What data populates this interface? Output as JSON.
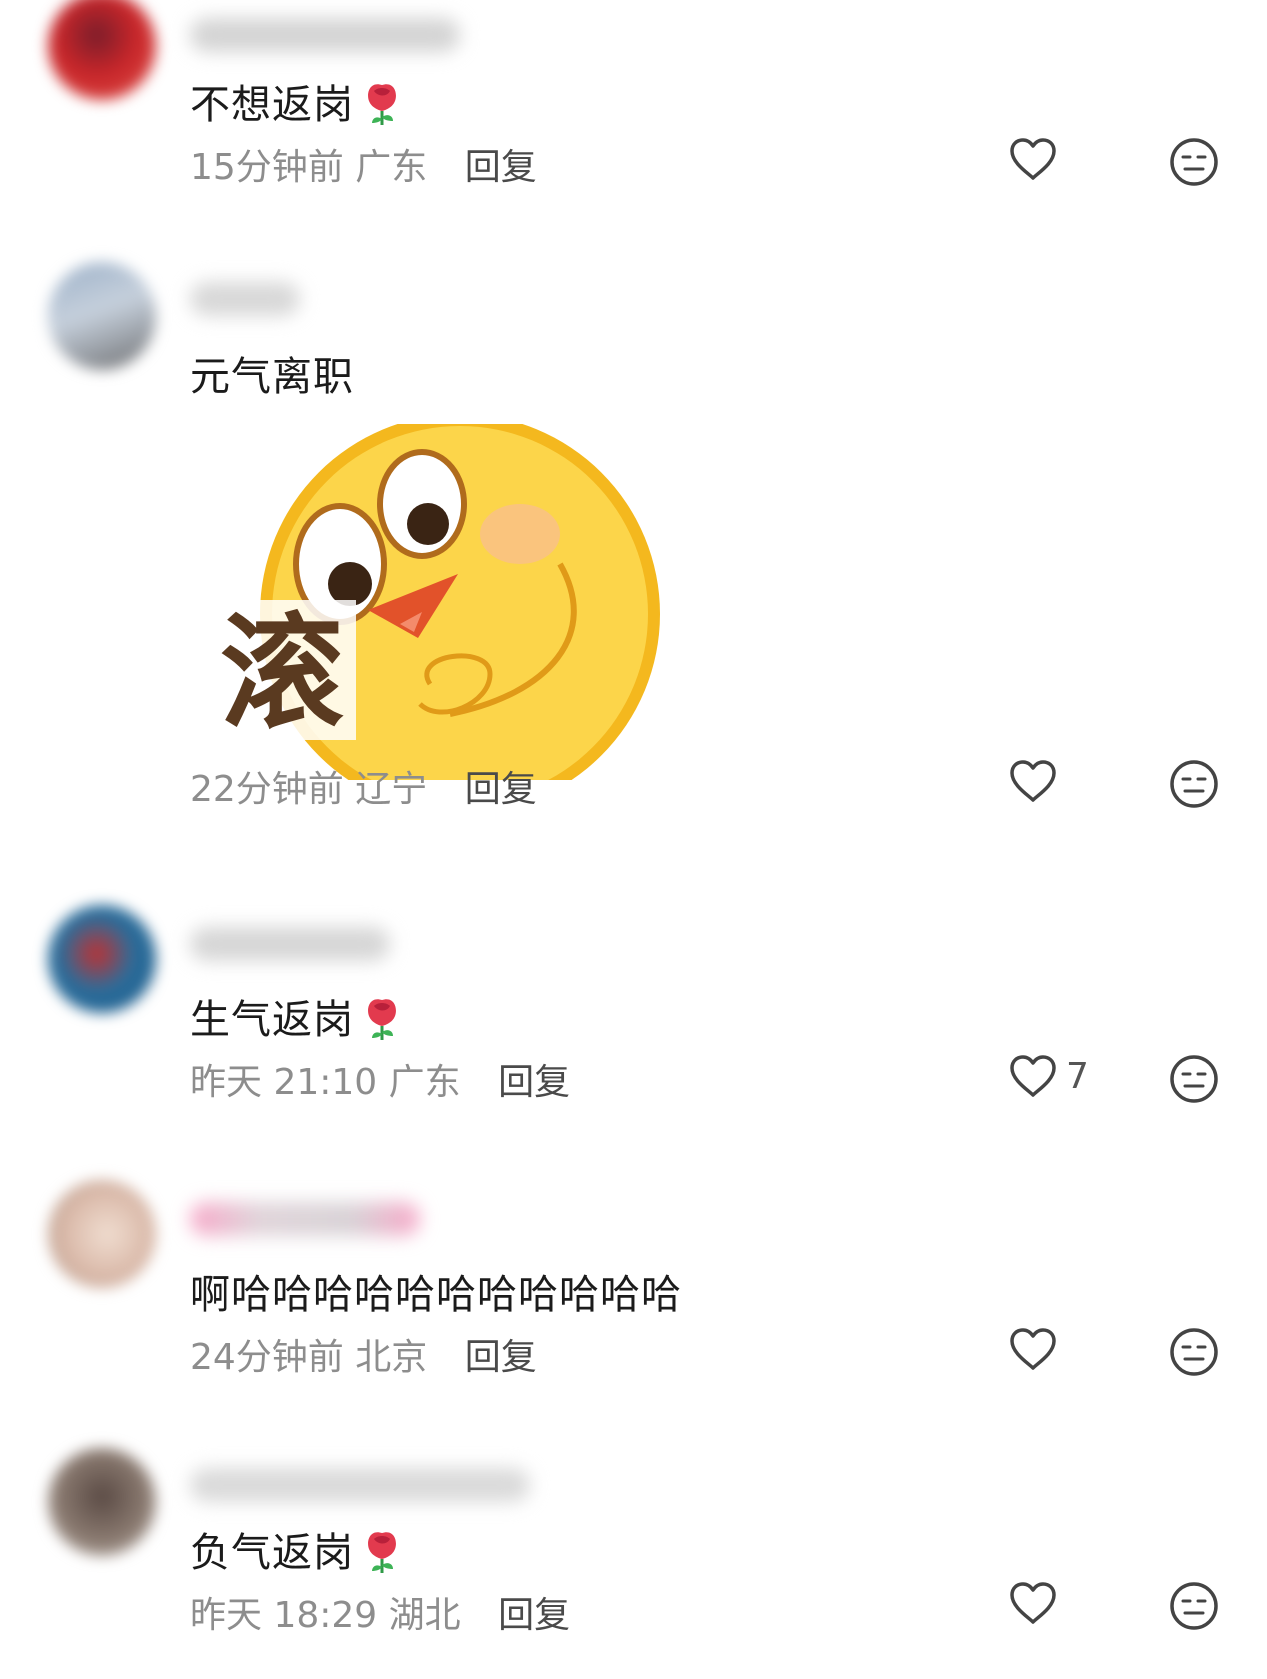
{
  "comments": [
    {
      "text": "不想返岗",
      "has_rose": true,
      "time": "15分钟前",
      "location": "广东",
      "reply_label": "回复",
      "like_count": "",
      "avatar_color": "#c8262a"
    },
    {
      "text": "元气离职",
      "has_rose": false,
      "sticker": {
        "icon": "emoji-sticker-icon",
        "label": "滚"
      },
      "time": "22分钟前",
      "location": "辽宁",
      "reply_label": "回复",
      "like_count": "",
      "avatar_color": "#7d8fa8"
    },
    {
      "text": "生气返岗",
      "has_rose": true,
      "time": "昨天 21:10",
      "location": "广东",
      "reply_label": "回复",
      "like_count": "7",
      "avatar_color": "#1f5d8c"
    },
    {
      "text": "啊哈哈哈哈哈哈哈哈哈哈哈",
      "has_rose": false,
      "time": "24分钟前",
      "location": "北京",
      "reply_label": "回复",
      "like_count": "",
      "avatar_color": "#d9b8a8"
    },
    {
      "text": "负气返岗",
      "has_rose": true,
      "time": "昨天 18:29",
      "location": "湖北",
      "reply_label": "回复",
      "like_count": "",
      "avatar_color": "#8a7a70"
    }
  ],
  "icons": {
    "like": "heart-outline-icon",
    "dislike": "neutral-face-icon",
    "rose": "rose-emoji-icon"
  },
  "colors": {
    "meta_text": "#8d8d8d",
    "reply_text": "#4a4a4a",
    "icon_stroke": "#444444"
  }
}
